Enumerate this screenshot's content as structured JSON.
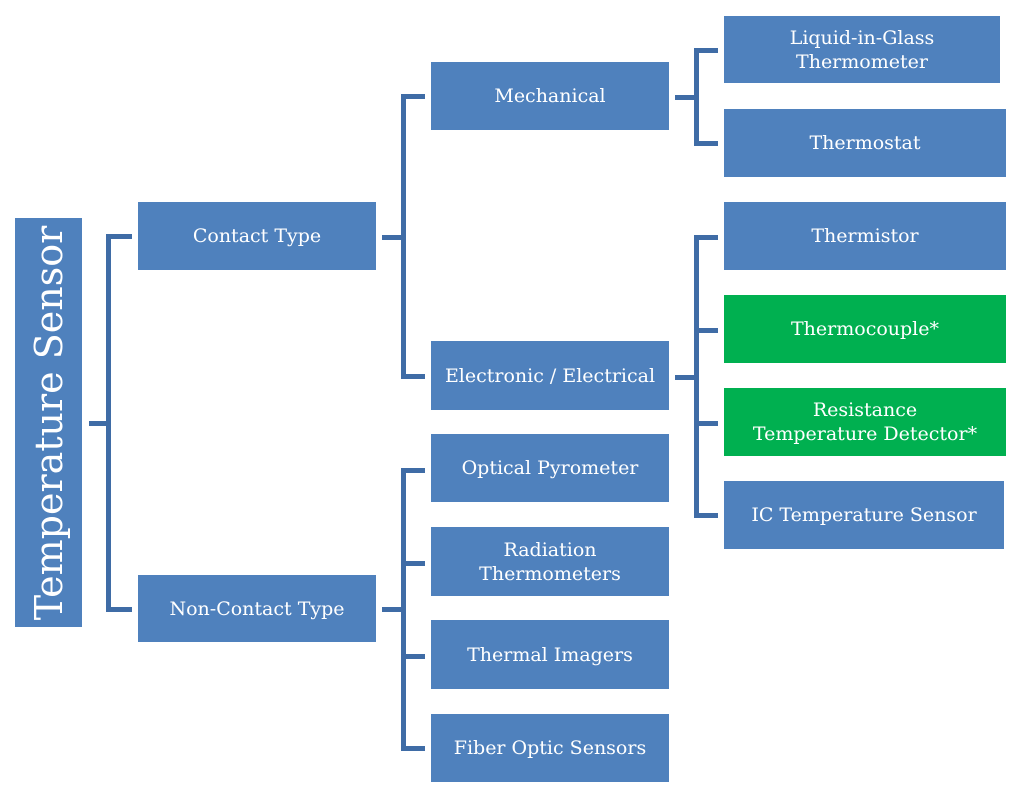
{
  "colors": {
    "node": "#4f81bd",
    "highlight": "#00b050",
    "connector": "#3f6ca6"
  },
  "root": {
    "label": "Temperature Sensor"
  },
  "level1": [
    {
      "label": "Contact Type"
    },
    {
      "label": "Non-Contact Type"
    }
  ],
  "contact": [
    {
      "label": "Mechanical"
    },
    {
      "label": "Electronic / Electrical"
    }
  ],
  "mechanical": [
    {
      "label": "Liquid-in-Glass\nThermometer"
    },
    {
      "label": "Thermostat"
    }
  ],
  "electronic": [
    {
      "label": "Thermistor",
      "highlighted": false
    },
    {
      "label": "Thermocouple*",
      "highlighted": true
    },
    {
      "label": "Resistance\nTemperature Detector*",
      "highlighted": true
    },
    {
      "label": "IC Temperature Sensor",
      "highlighted": false
    }
  ],
  "noncontact": [
    {
      "label": "Optical Pyrometer"
    },
    {
      "label": "Radiation\nThermometers"
    },
    {
      "label": "Thermal Imagers"
    },
    {
      "label": "Fiber Optic Sensors"
    }
  ]
}
